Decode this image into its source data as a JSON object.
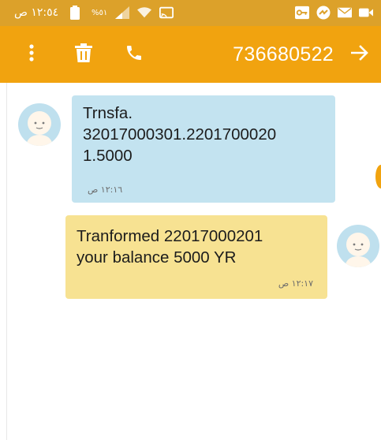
{
  "status_bar": {
    "time": "١٢:٥٤ ص",
    "battery": "%٥١",
    "icons": [
      "battery-icon",
      "signal-icon",
      "wifi-icon",
      "cast-icon",
      "key-icon",
      "messenger-icon",
      "mail-icon",
      "video-icon"
    ]
  },
  "toolbar": {
    "title": "736680522",
    "icons": [
      "more-vert-icon",
      "delete-icon",
      "phone-icon",
      "arrow-forward-icon"
    ]
  },
  "messages": [
    {
      "direction": "incoming",
      "text": "Trnsfa.\n32017000301.2201700020\n1.5000",
      "time": "١٢:١٦ ص"
    },
    {
      "direction": "outgoing",
      "text": "Tranformed 22017000201\nyour balance 5000  YR",
      "time": "١٢:١٧ ص"
    }
  ],
  "colors": {
    "status_bar": "#dca12a",
    "toolbar": "#f1a30f",
    "incoming_bubble": "#c3e3f0",
    "outgoing_bubble": "#f7e292"
  }
}
